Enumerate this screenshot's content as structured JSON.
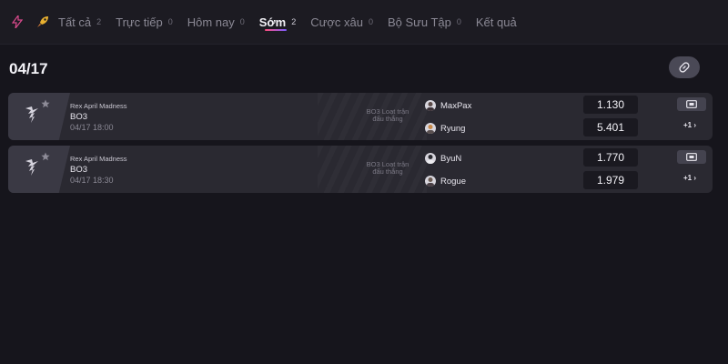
{
  "nav": {
    "tabs": [
      {
        "label": "Tất cả",
        "count": "2"
      },
      {
        "label": "Trực tiếp",
        "count": "0"
      },
      {
        "label": "Hôm nay",
        "count": "0"
      },
      {
        "label": "Sớm",
        "count": "2"
      },
      {
        "label": "Cược xâu",
        "count": "0"
      },
      {
        "label": "Bộ Sưu Tập",
        "count": "0"
      },
      {
        "label": "Kết quả",
        "count": ""
      }
    ],
    "active_tab": "Sớm",
    "accent_colors": [
      "#ff4f7b",
      "#7a5cff"
    ]
  },
  "date_group": "04/17",
  "matches": [
    {
      "league": "Rex April Madness",
      "format": "BO3",
      "time": "04/17 18:00",
      "type_line1": "BO3 Loạt trận",
      "type_line2": "đấu thắng",
      "team1": {
        "name": "MaxPax",
        "odds": "1.130"
      },
      "team2": {
        "name": "Ryung",
        "odds": "5.401"
      },
      "more": "+1 ›"
    },
    {
      "league": "Rex April Madness",
      "format": "BO3",
      "time": "04/17 18:30",
      "type_line1": "BO3 Loạt trận",
      "type_line2": "đấu thắng",
      "team1": {
        "name": "ByuN",
        "odds": "1.770"
      },
      "team2": {
        "name": "Rogue",
        "odds": "1.979"
      },
      "more": "+1 ›"
    }
  ],
  "icons": {
    "tab_live": "lightning-icon",
    "tab_early": "rocket-icon",
    "share": "link-icon",
    "stream": "screen-icon",
    "favorite": "star-icon",
    "game": "starcraft-logo-icon"
  }
}
